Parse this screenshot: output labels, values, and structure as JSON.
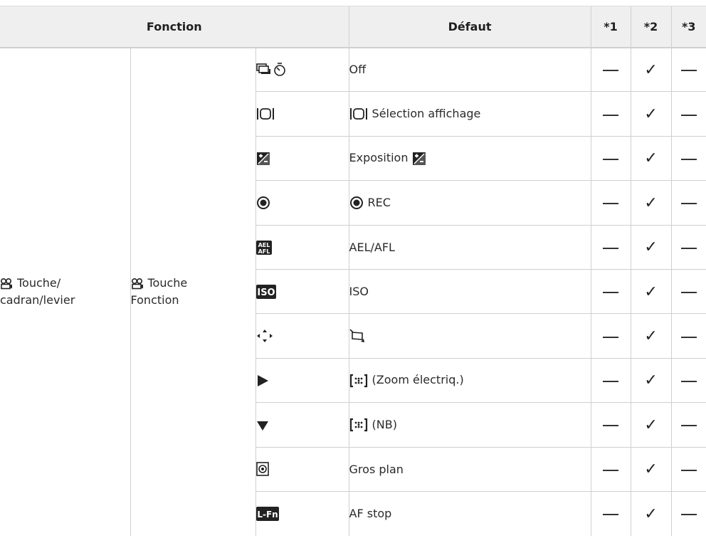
{
  "table": {
    "headers": {
      "function": "Fonction",
      "default": "Défaut",
      "col1": "*1",
      "col2": "*2",
      "col3": "*3"
    },
    "group_label_line1": "Touche/",
    "group_label_line2": "cadran/levier",
    "subgroup_label_line1": "Touche",
    "subgroup_label_line2": "Fonction",
    "rows": [
      {
        "icon": "sequential-self-timer-icon",
        "default": "Off",
        "col1": "—",
        "col2": "✓",
        "col3": "—"
      },
      {
        "icon": "display-selection-icon",
        "default": "Sélection affichage",
        "col1": "—",
        "col2": "✓",
        "col3": "—"
      },
      {
        "icon": "exposure-compensation-icon",
        "default": "Exposition",
        "col1": "—",
        "col2": "✓",
        "col3": "—"
      },
      {
        "icon": "rec-icon",
        "default": "REC",
        "col1": "—",
        "col2": "✓",
        "col3": "—"
      },
      {
        "icon": "ael-afl-icon",
        "default": "AEL/AFL",
        "col1": "—",
        "col2": "✓",
        "col3": "—"
      },
      {
        "icon": "iso-icon",
        "default": "ISO",
        "col1": "—",
        "col2": "✓",
        "col3": "—"
      },
      {
        "icon": "arrow-pad-icon",
        "default": "",
        "col1": "—",
        "col2": "✓",
        "col3": "—"
      },
      {
        "icon": "play-right-icon",
        "default": "(Zoom électriq.)",
        "col1": "—",
        "col2": "✓",
        "col3": "—"
      },
      {
        "icon": "down-triangle-icon",
        "default": "(NB)",
        "col1": "—",
        "col2": "✓",
        "col3": "—"
      },
      {
        "icon": "close-up-icon",
        "default": "Gros plan",
        "col1": "—",
        "col2": "✓",
        "col3": "—"
      },
      {
        "icon": "l-fn-icon",
        "default": "AF stop",
        "col1": "—",
        "col2": "✓",
        "col3": "—"
      }
    ]
  }
}
